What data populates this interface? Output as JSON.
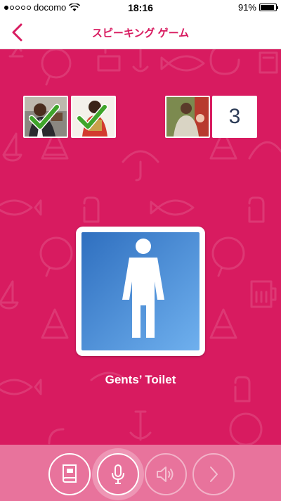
{
  "status_bar": {
    "carrier": "docomo",
    "time": "18:16",
    "battery": "91%",
    "battery_level": 0.91
  },
  "nav": {
    "title": "スピーキング ゲーム",
    "back_icon": "chevron-left-icon"
  },
  "progress": {
    "counter": "3",
    "completed_icon": "checkmark-icon"
  },
  "card": {
    "icon": "male-toilet-icon",
    "caption": "Gents’ Toilet"
  },
  "toolbar": {
    "buttons": [
      {
        "icon": "book-icon",
        "enabled": true
      },
      {
        "icon": "microphone-icon",
        "enabled": true,
        "active": true
      },
      {
        "icon": "speaker-icon",
        "enabled": false
      },
      {
        "icon": "chevron-right-icon",
        "enabled": false
      }
    ]
  },
  "colors": {
    "primary": "#d81b60",
    "toolbar": "#e8739c",
    "sign_blue": "#3f7fcf",
    "check_green": "#3fa52b",
    "counter_text": "#2b3a55"
  }
}
